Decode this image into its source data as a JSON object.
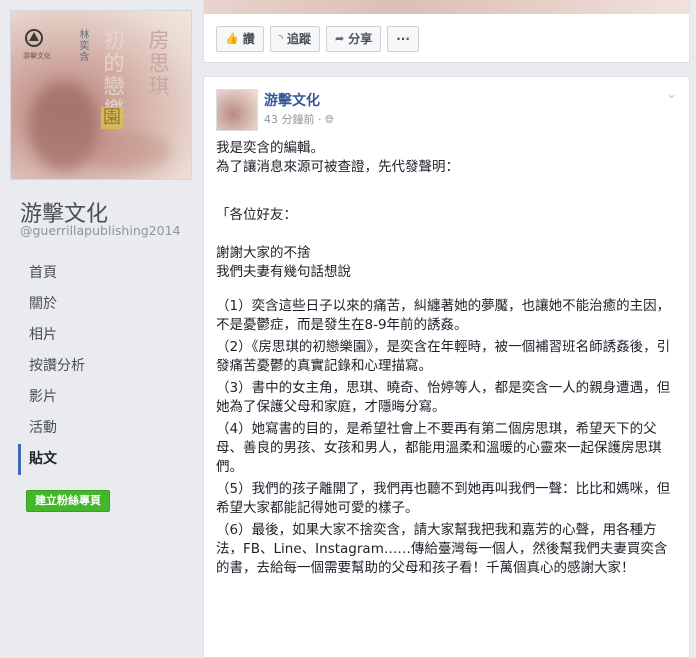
{
  "sidebar": {
    "cover": {
      "publisher_mark": "游擊文化",
      "author": "林奕含",
      "title_col1": "房思琪",
      "title_col2": "初的戀樂",
      "title_yuan": "園"
    },
    "page_name": "游擊文化",
    "page_handle": "@guerrillapublishing2014",
    "nav": [
      {
        "label": "首頁"
      },
      {
        "label": "關於"
      },
      {
        "label": "相片"
      },
      {
        "label": "按讚分析"
      },
      {
        "label": "影片"
      },
      {
        "label": "活動"
      },
      {
        "label": "貼文"
      }
    ],
    "create_fan_page": "建立粉絲專頁"
  },
  "actions": {
    "like": "讚",
    "follow": "追蹤",
    "share": "分享",
    "more": "···"
  },
  "post": {
    "author": "游擊文化",
    "time": "43 分鐘前 · ",
    "privacy_icon": "globe-icon",
    "lines": {
      "l1": "我是奕含的編輯。",
      "l2": "為了讓消息來源可被查證，先代發聲明：",
      "l3": "「各位好友：",
      "l4": "謝謝大家的不捨",
      "l5": "我們夫妻有幾句話想說",
      "p1": "（1）奕含這些日子以來的痛苦，糾纏著她的夢魘，也讓她不能治癒的主因，不是憂鬱症，而是發生在8-9年前的誘姦。",
      "p2": "（2）《房思琪的初戀樂園》，是奕含在年輕時，被一個補習班名師誘姦後，引發痛苦憂鬱的真實記錄和心理描寫。",
      "p3": "（3）書中的女主角，思琪、曉奇、怡婷等人，都是奕含一人的親身遭遇，但她為了保護父母和家庭，才隱晦分寫。",
      "p4": "（4）她寫書的目的，是希望社會上不要再有第二個房思琪，希望天下的父母、善良的男孩、女孩和男人，都能用溫柔和溫暖的心靈來一起保護房思琪們。",
      "p5": "（5）我們的孩子離開了，我們再也聽不到她再叫我們一聲：比比和媽咪，但希望大家都能記得她可愛的樣子。",
      "p6": "（6）最後，如果大家不捨奕含，請大家幫我把我和嘉芳的心聲，用各種方法，FB、Line、Instagram……傳給臺灣每一個人，然後幫我們夫妻買奕含的書，去給每一個需要幫助的父母和孩子看！千萬個真心的感謝大家！"
    }
  }
}
